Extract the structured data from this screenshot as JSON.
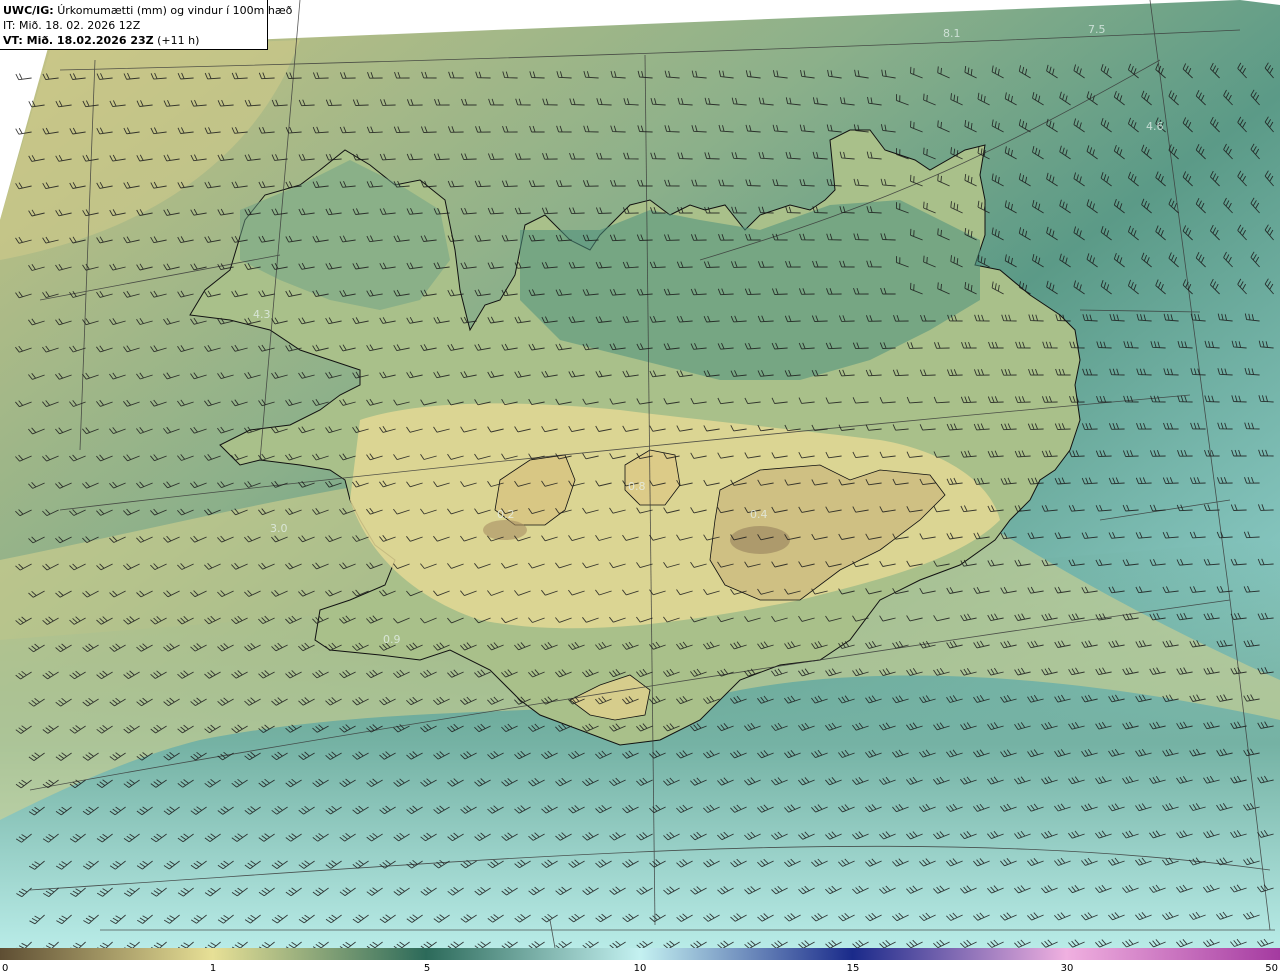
{
  "header": {
    "product": "UWC/IG:",
    "title": "Úrkomumætti (mm) og vindur í 100m hæð",
    "analysis_time": "IT: Mið. 18. 02. 2026 12Z",
    "valid_prefix": "VT: Mið. 18.02.2026 23Z",
    "valid_offset": "(+11 h)"
  },
  "map_labels": [
    {
      "text": "8.1"
    },
    {
      "text": "7.5"
    },
    {
      "text": "4.3"
    },
    {
      "text": "3.0"
    },
    {
      "text": "0.2"
    },
    {
      "text": "0.4"
    },
    {
      "text": "0.8"
    },
    {
      "text": "0.9"
    },
    {
      "text": "4.6"
    }
  ],
  "colorbar": {
    "ticks": [
      "0",
      "1",
      "5",
      "10",
      "15",
      "30",
      "50"
    ],
    "colors": [
      "#5e4e33",
      "#e7e096",
      "#2c6a5a",
      "#c4f1f1",
      "#1a2a8a",
      "#f0b0e0",
      "#a43aa0"
    ]
  },
  "colors": {
    "wind_barb": "#1a1a1a",
    "coastline": "#111111"
  }
}
